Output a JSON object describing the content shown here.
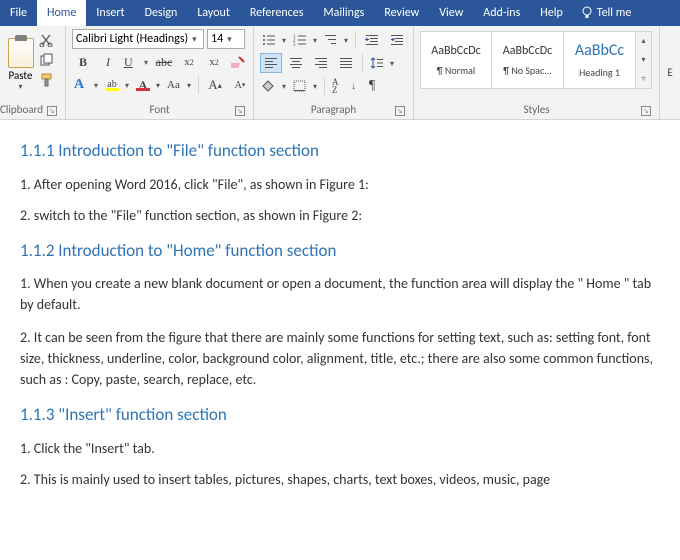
{
  "menu": {
    "file": "File",
    "home": "Home",
    "insert": "Insert",
    "design": "Design",
    "layout": "Layout",
    "references": "References",
    "mailings": "Mailings",
    "review": "Review",
    "view": "View",
    "addins": "Add-ins",
    "help": "Help",
    "tellme": "Tell me"
  },
  "ribbon": {
    "clipboard": {
      "paste": "Paste",
      "label": "Clipboard"
    },
    "font": {
      "name": "Calibri Light (Headings)",
      "size": "14",
      "label": "Font"
    },
    "paragraph": {
      "label": "Paragraph"
    },
    "styles": {
      "label": "Styles",
      "items": [
        {
          "preview": "AaBbCcDc",
          "name": "¶ Normal",
          "size": "12px",
          "color": "#333"
        },
        {
          "preview": "AaBbCcDc",
          "name": "¶ No Spac...",
          "size": "12px",
          "color": "#333"
        },
        {
          "preview": "AaBbCc",
          "name": "Heading 1",
          "size": "16px",
          "color": "#2e74b5"
        }
      ]
    },
    "editing": "Editing"
  },
  "document": {
    "h1": "1.1.1 Introduction to \"File\" function section",
    "p1": "1. After opening Word 2016, click \"File\", as shown in Figure 1:",
    "p2": "2. switch to the \"File\" function section, as shown in Figure 2:",
    "h2": "1.1.2 Introduction to \"Home\" function section",
    "p3": "1. When you create a new blank document or open a document, the function area will display the \" Home \" tab by default.",
    "p4": "2. It can be seen from the figure that there are mainly some functions for setting text, such as: setting font, font size, thickness, underline, color, background color, alignment, title, etc.; there are also some common functions, such as : Copy, paste, search, replace, etc.",
    "h3": "1.1.3 \"Insert\" function section",
    "p5": "1. Click the \"Insert\" tab.",
    "p6": "2. This is mainly used to insert tables, pictures, shapes, charts, text boxes, videos, music, page"
  }
}
